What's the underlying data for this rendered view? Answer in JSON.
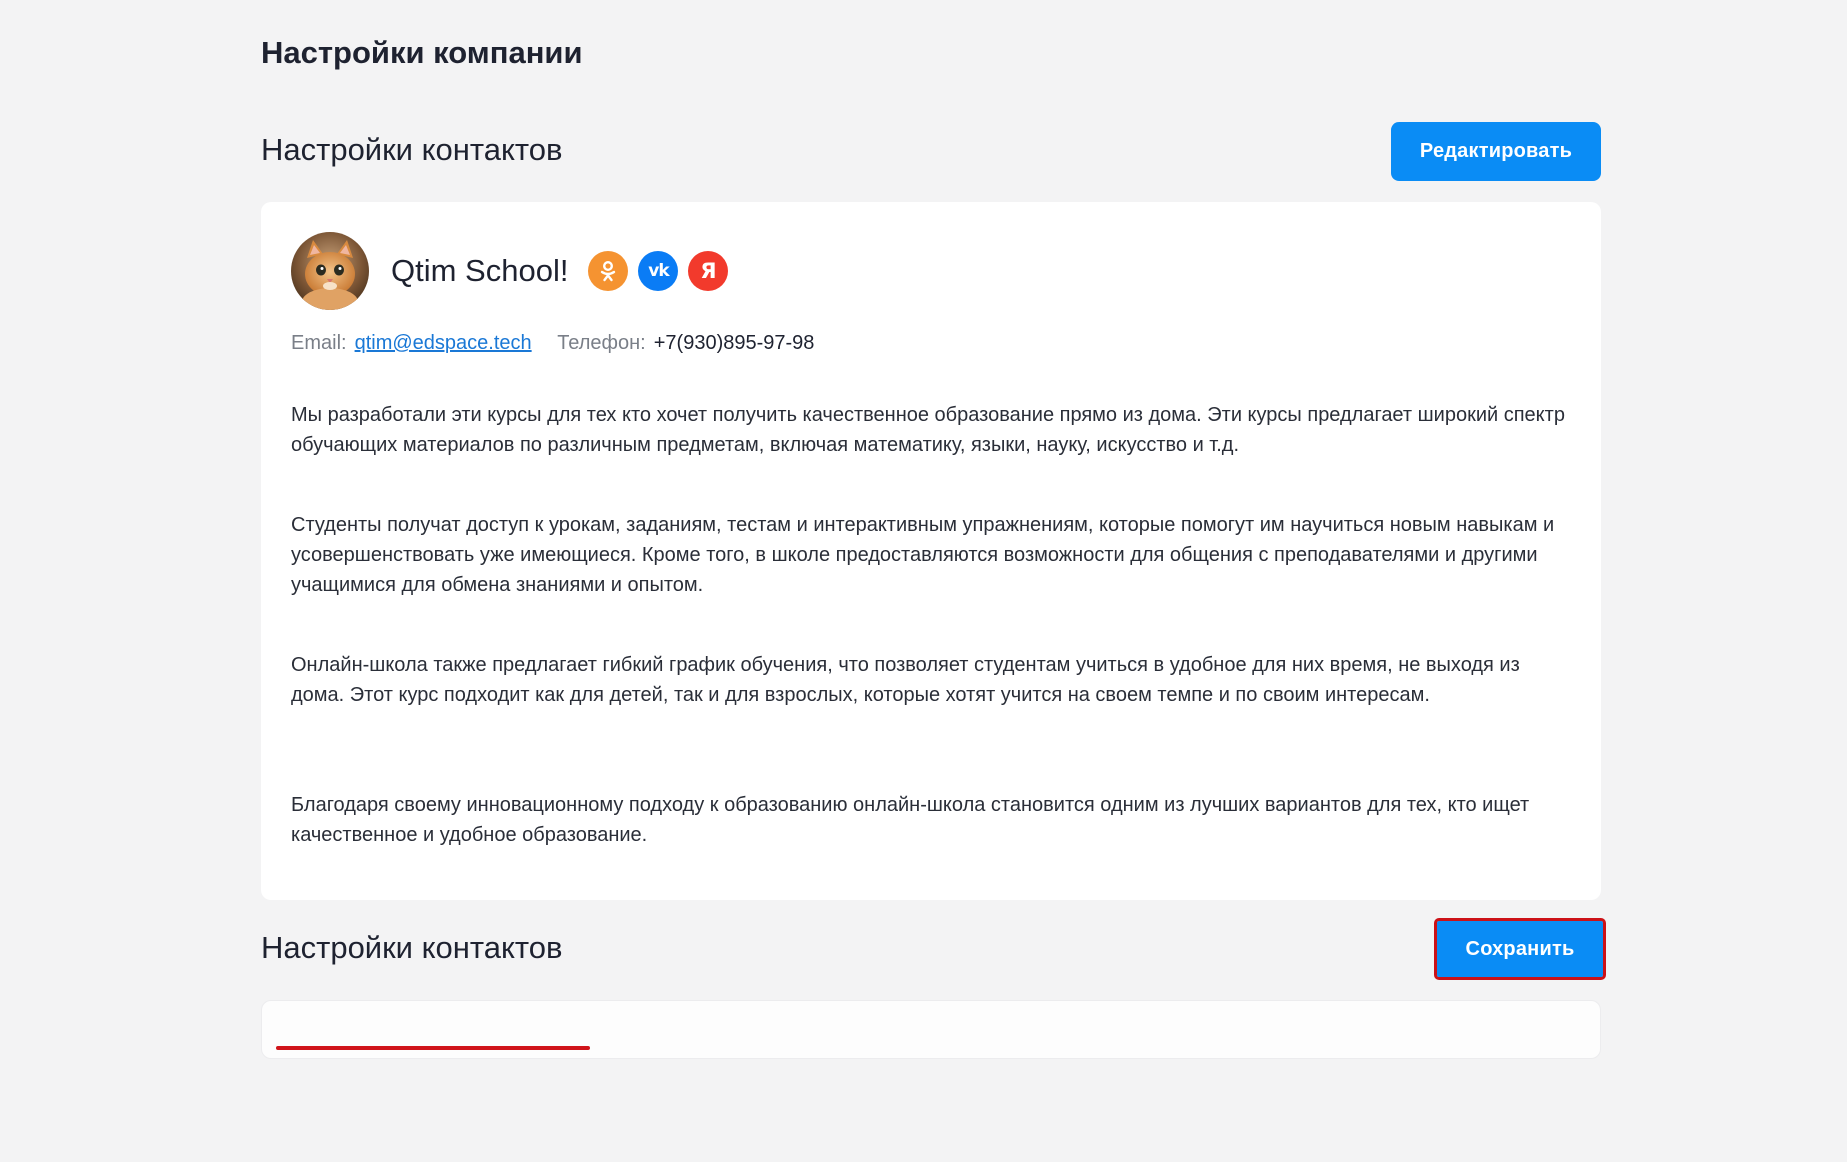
{
  "page": {
    "title": "Настройки компании"
  },
  "contacts_section": {
    "title": "Настройки контактов",
    "edit_button_label": "Редактировать"
  },
  "profile": {
    "company_name": "Qtim School!",
    "avatar_icon": "cat-avatar",
    "socials": [
      {
        "name": "odnoklassniki-icon",
        "glyph": "ок",
        "color": "#f59331"
      },
      {
        "name": "vk-icon",
        "glyph": "vk",
        "color": "#0a7cf5"
      },
      {
        "name": "yandex-icon",
        "glyph": "Я",
        "color": "#f23a2c"
      }
    ],
    "email_label": "Email:",
    "email": "qtim@edspace.tech",
    "phone_label": "Телефон:",
    "phone": "+7(930)895-97-98"
  },
  "description": [
    "Мы разработали эти курсы для тех кто хочет получить качественное образование прямо из дома. Эти курсы предлагает широкий спектр обучающих материалов по различным предметам, включая математику, языки, науку, искусство и т.д.",
    "Студенты получат доступ к урокам, заданиям, тестам и интерактивным упражнениям, которые помогут им научиться новым навыкам и усовершенствовать уже имеющиеся. Кроме того, в школе предоставляются возможности для общения с преподавателями и другими учащимися для обмена знаниями и опытом.",
    "Онлайн-школа также предлагает гибкий график обучения, что позволяет студентам учиться в удобное для них время, не выходя из дома. Этот курс подходит как для детей, так и для взрослых, которые хотят учится на своем темпе и по своим интересам.",
    "Благодаря своему инновационному подходу к образованию онлайн-школа становится одним из лучших вариантов для тех, кто ищет качественное и удобное образование."
  ],
  "contacts_section_2": {
    "title": "Настройки контактов",
    "save_button_label": "Сохранить"
  },
  "colors": {
    "primary": "#0a8cf5",
    "highlight": "#cc1117",
    "background": "#f3f3f4"
  }
}
